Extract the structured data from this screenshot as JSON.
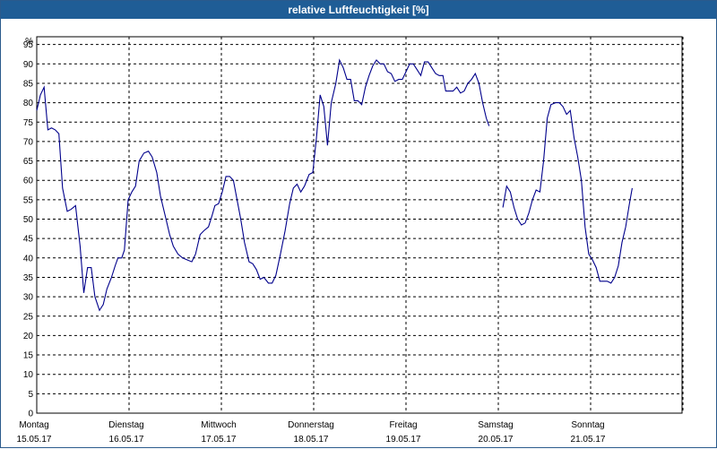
{
  "window": {
    "title": "relative Luftfeuchtigkeit [%]"
  },
  "colors": {
    "titlebar": "#1f5d96",
    "line": "#00008b",
    "grid": "#000000",
    "frame": "#2a5a8c"
  },
  "chart_data": {
    "type": "line",
    "title": "relative Luftfeuchtigkeit [%]",
    "ylabel": "%",
    "ylim": [
      0,
      97
    ],
    "yticks": [
      0,
      5,
      10,
      15,
      20,
      25,
      30,
      35,
      40,
      45,
      50,
      55,
      60,
      65,
      70,
      75,
      80,
      85,
      90,
      95
    ],
    "grid": true,
    "legend": "none",
    "xlim": [
      0,
      7.1
    ],
    "day_ticks": [
      {
        "x": 0,
        "day": "Montag",
        "date": "15.05.17"
      },
      {
        "x": 1,
        "day": "Dienstag",
        "date": "16.05.17"
      },
      {
        "x": 2,
        "day": "Mittwoch",
        "date": "17.05.17"
      },
      {
        "x": 3,
        "day": "Donnerstag",
        "date": "18.05.17"
      },
      {
        "x": 4,
        "day": "Freitag",
        "date": "19.05.17"
      },
      {
        "x": 5,
        "day": "Samstag",
        "date": "20.05.17"
      },
      {
        "x": 6,
        "day": "Sonntag",
        "date": "21.05.17"
      }
    ],
    "series": [
      {
        "segments": [
          [
            [
              0.0,
              78
            ],
            [
              0.04,
              82
            ],
            [
              0.08,
              84
            ],
            [
              0.12,
              73
            ],
            [
              0.16,
              73.5
            ],
            [
              0.2,
              73
            ],
            [
              0.24,
              72
            ],
            [
              0.28,
              58
            ],
            [
              0.33,
              52
            ],
            [
              0.37,
              52.5
            ],
            [
              0.42,
              53.5
            ],
            [
              0.47,
              43
            ],
            [
              0.51,
              31
            ],
            [
              0.55,
              37.5
            ],
            [
              0.59,
              37.5
            ],
            [
              0.63,
              30
            ],
            [
              0.68,
              26.5
            ],
            [
              0.72,
              28
            ],
            [
              0.76,
              32
            ],
            [
              0.81,
              35
            ],
            [
              0.85,
              38
            ],
            [
              0.88,
              40
            ],
            [
              0.92,
              40
            ],
            [
              0.95,
              42
            ],
            [
              0.99,
              55
            ],
            [
              1.03,
              57
            ],
            [
              1.07,
              58.5
            ],
            [
              1.11,
              65
            ],
            [
              1.16,
              67
            ],
            [
              1.21,
              67.5
            ],
            [
              1.25,
              66
            ],
            [
              1.3,
              62
            ],
            [
              1.34,
              56
            ],
            [
              1.39,
              51
            ],
            [
              1.44,
              46
            ],
            [
              1.48,
              43
            ],
            [
              1.53,
              41
            ],
            [
              1.58,
              40
            ],
            [
              1.63,
              39.5
            ],
            [
              1.68,
              39
            ],
            [
              1.72,
              41
            ],
            [
              1.77,
              46
            ],
            [
              1.81,
              47
            ],
            [
              1.86,
              48
            ],
            [
              1.9,
              51
            ],
            [
              1.93,
              53.5
            ],
            [
              1.97,
              54
            ],
            [
              2.01,
              57
            ],
            [
              2.05,
              61
            ],
            [
              2.09,
              61
            ],
            [
              2.13,
              60
            ],
            [
              2.17,
              55
            ],
            [
              2.21,
              50
            ],
            [
              2.25,
              44
            ],
            [
              2.3,
              39
            ],
            [
              2.34,
              38.5
            ],
            [
              2.38,
              37
            ],
            [
              2.42,
              34.5
            ],
            [
              2.46,
              35
            ],
            [
              2.51,
              33.5
            ],
            [
              2.55,
              33.5
            ],
            [
              2.59,
              35.5
            ],
            [
              2.64,
              41
            ],
            [
              2.69,
              47
            ],
            [
              2.74,
              54
            ],
            [
              2.78,
              58
            ],
            [
              2.82,
              59
            ],
            [
              2.86,
              57
            ],
            [
              2.9,
              58.5
            ],
            [
              2.95,
              61.5
            ],
            [
              2.99,
              62
            ],
            [
              3.03,
              71
            ],
            [
              3.07,
              82
            ],
            [
              3.11,
              79
            ],
            [
              3.15,
              69
            ],
            [
              3.19,
              80
            ],
            [
              3.24,
              85
            ],
            [
              3.28,
              91
            ],
            [
              3.32,
              89
            ],
            [
              3.36,
              86
            ],
            [
              3.4,
              86
            ],
            [
              3.44,
              80.5
            ],
            [
              3.48,
              80.5
            ],
            [
              3.52,
              79.5
            ],
            [
              3.56,
              84
            ],
            [
              3.6,
              87
            ],
            [
              3.64,
              89.5
            ],
            [
              3.68,
              91
            ],
            [
              3.72,
              90
            ],
            [
              3.76,
              90
            ],
            [
              3.8,
              88
            ],
            [
              3.84,
              87.5
            ],
            [
              3.88,
              85.5
            ],
            [
              3.92,
              86
            ],
            [
              3.96,
              86
            ],
            [
              4.0,
              88
            ],
            [
              4.04,
              90
            ],
            [
              4.08,
              90
            ],
            [
              4.12,
              88.5
            ],
            [
              4.16,
              87
            ],
            [
              4.2,
              90.5
            ],
            [
              4.24,
              90.5
            ],
            [
              4.28,
              89
            ],
            [
              4.32,
              87.5
            ],
            [
              4.36,
              87
            ],
            [
              4.4,
              87
            ],
            [
              4.43,
              83
            ],
            [
              4.47,
              83
            ],
            [
              4.51,
              83
            ],
            [
              4.55,
              84
            ],
            [
              4.59,
              82.5
            ],
            [
              4.63,
              83
            ],
            [
              4.67,
              85
            ],
            [
              4.71,
              86
            ],
            [
              4.75,
              87.5
            ],
            [
              4.79,
              85
            ],
            [
              4.83,
              80
            ],
            [
              4.87,
              76
            ],
            [
              4.9,
              74
            ]
          ],
          [
            [
              5.05,
              53
            ],
            [
              5.09,
              58.5
            ],
            [
              5.13,
              57
            ],
            [
              5.17,
              53
            ],
            [
              5.21,
              50
            ],
            [
              5.25,
              48.5
            ],
            [
              5.29,
              49
            ],
            [
              5.33,
              51.5
            ],
            [
              5.37,
              55
            ],
            [
              5.41,
              57.5
            ],
            [
              5.45,
              57
            ],
            [
              5.49,
              65
            ],
            [
              5.53,
              76
            ],
            [
              5.57,
              79.5
            ],
            [
              5.62,
              80
            ],
            [
              5.66,
              80
            ],
            [
              5.7,
              79
            ],
            [
              5.74,
              77
            ],
            [
              5.78,
              78
            ],
            [
              5.82,
              71
            ],
            [
              5.86,
              66
            ],
            [
              5.9,
              60
            ],
            [
              5.94,
              48
            ],
            [
              5.98,
              41
            ],
            [
              6.02,
              39.5
            ],
            [
              6.06,
              37.5
            ],
            [
              6.1,
              34
            ],
            [
              6.14,
              34
            ],
            [
              6.18,
              34
            ],
            [
              6.22,
              33.5
            ],
            [
              6.26,
              35
            ],
            [
              6.3,
              38
            ],
            [
              6.34,
              44
            ],
            [
              6.38,
              48
            ],
            [
              6.42,
              54
            ],
            [
              6.45,
              58
            ]
          ]
        ]
      }
    ]
  }
}
